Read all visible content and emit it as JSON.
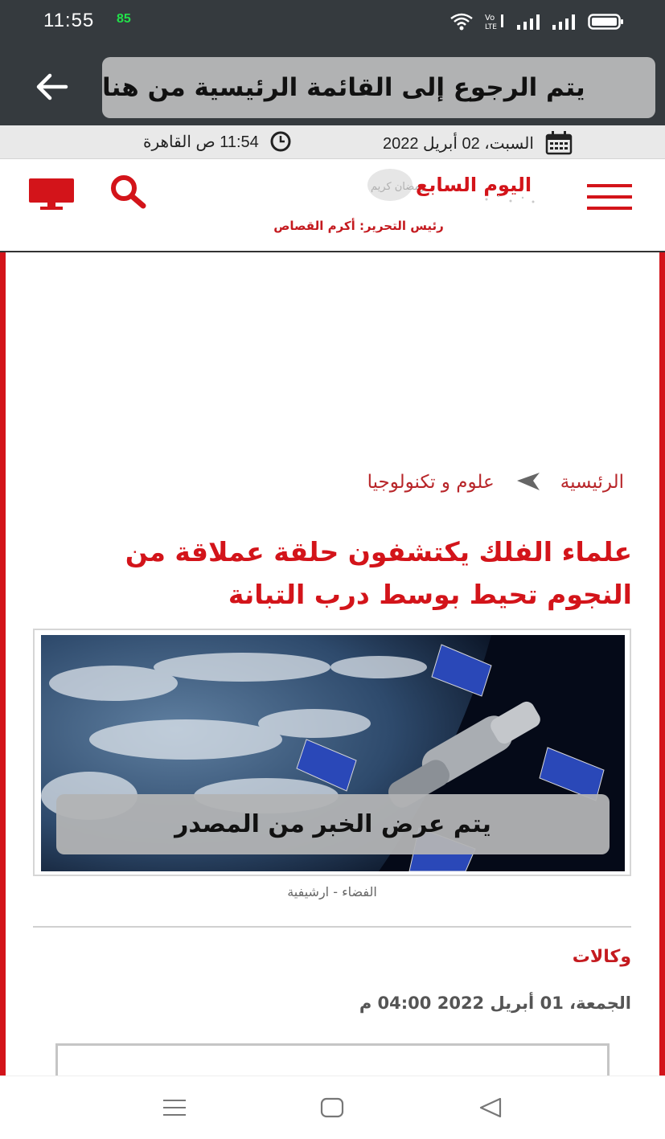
{
  "status_bar": {
    "time": "11:55",
    "battery_badge": "85",
    "icons": [
      "wifi-icon",
      "volte-icon",
      "signal-icon",
      "signal-icon",
      "battery-icon"
    ]
  },
  "app_bar": {
    "back_icon": "arrow-left-icon",
    "notice": "يتم الرجوع إلى القائمة الرئيسية من هنا"
  },
  "date_bar": {
    "date": "السبت، 02 أبريل 2022",
    "time": "11:54 ص القاهرة"
  },
  "site_header": {
    "logo_text": "اليوم السابع",
    "logo_tag": "رمضان كريم",
    "editor": "رئيس التحرير: أكرم القصاص"
  },
  "breadcrumb": {
    "home": "الرئيسية",
    "section": "علوم و تكنولوجيا"
  },
  "article": {
    "headline": "علماء الفلك يكتشفون حلقة عملاقة من النجوم تحيط بوسط درب التبانة",
    "image_overlay": "يتم عرض الخبر من المصدر",
    "caption": "الفضاء - ارشيفية",
    "agency": "وكالات",
    "published": "الجمعة، 01 أبريل 2022 04:00 م"
  },
  "colors": {
    "brand_red": "#d3141a",
    "bar_dark": "#353a3e"
  }
}
